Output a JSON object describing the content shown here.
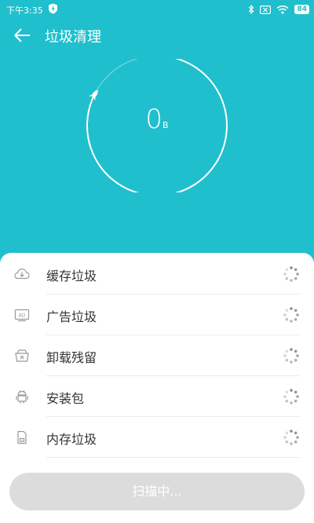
{
  "status_bar": {
    "time": "下午3:35",
    "battery": "84",
    "icons": [
      "shield-icon",
      "bluetooth-icon",
      "sim-icon",
      "wifi-icon",
      "battery-icon"
    ]
  },
  "header": {
    "title": "垃圾清理",
    "back_icon": "arrow-left-icon"
  },
  "gauge": {
    "value": "0",
    "unit": "B"
  },
  "items": [
    {
      "label": "缓存垃圾",
      "icon": "cloud-download-icon",
      "status": "loading"
    },
    {
      "label": "广告垃圾",
      "icon": "ad-icon",
      "status": "loading"
    },
    {
      "label": "卸载残留",
      "icon": "uninstall-icon",
      "status": "loading"
    },
    {
      "label": "安装包",
      "icon": "android-icon",
      "status": "loading"
    },
    {
      "label": "内存垃圾",
      "icon": "memory-card-icon",
      "status": "loading"
    }
  ],
  "scan_button": {
    "label": "扫描中..."
  },
  "colors": {
    "primary": "#20bfcd",
    "button_disabled": "#dcdcdc"
  }
}
